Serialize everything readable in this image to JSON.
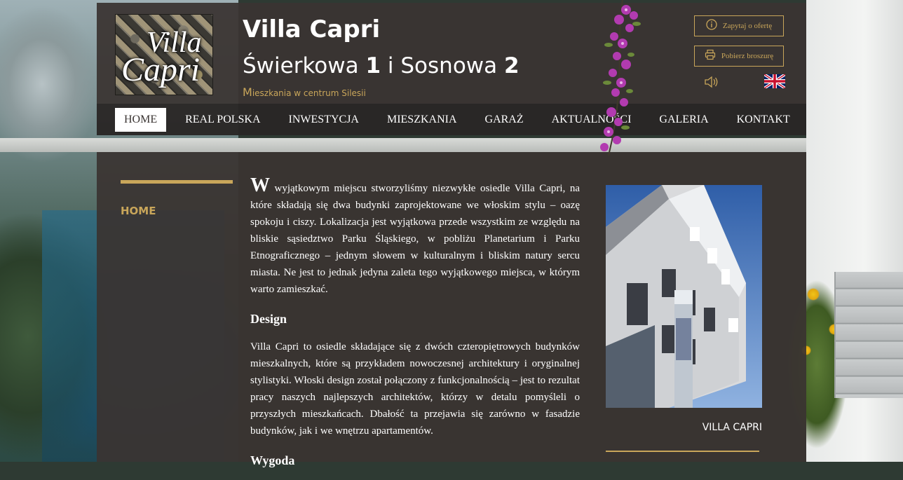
{
  "header": {
    "logo_line1": "Villa",
    "logo_line2": "Capri",
    "title": "Villa Capri",
    "subtitle": {
      "street1": "Świerkowa ",
      "num1": "1",
      "mid": " i Sosnowa ",
      "num2": "2"
    },
    "tagline_initial": "M",
    "tagline_rest": "ieszkania w centrum Silesii",
    "buttons": {
      "offer_label": "Zapytaj o ofertę",
      "brochure_label": "Pobierz broszurę"
    }
  },
  "nav": {
    "items": [
      {
        "label": "HOME"
      },
      {
        "label": "REAL POLSKA"
      },
      {
        "label": "INWESTYCJA"
      },
      {
        "label": "MIESZKANIA"
      },
      {
        "label": "GARAŻ"
      },
      {
        "label": "AKTUALNOŚCI"
      },
      {
        "label": "GALERIA"
      },
      {
        "label": "KONTAKT"
      }
    ]
  },
  "sidebar": {
    "link": "HOME"
  },
  "article": {
    "intro_cap": "W",
    "intro_rest": " wyjątkowym miejscu stworzyliśmy niezwykłe osiedle Villa Capri, na które składają się dwa budynki zaprojektowane we włoskim stylu – oazę spokoju i ciszy. Lokalizacja jest wyjątkowa przede wszystkim ze względu na bliskie sąsiedztwo Parku Śląskiego, w pobliżu Planetarium i Parku Etnograficznego – jednym słowem w kulturalnym i bliskim natury sercu miasta. Ne jest to jednak jedyna zaleta tego wyjątkowego miejsca, w którym warto zamieszkać.",
    "design_heading": "Design",
    "design_text": "Villa Capri to osiedle składające się z dwóch czteropiętrowych budynków mieszkalnych, które są przykładem nowoczesnej architektury i oryginalnej stylistyki. Włoski design został połączony z funkcjonalnością – jest to rezultat pracy naszych najlepszych architektów, którzy w detalu pomyśleli o przyszłych mieszkańcach. Dbałość ta przejawia się zarówno w fasadzie budynków, jak i we wnętrzu apartamentów.",
    "next_heading": "Wygoda"
  },
  "photo": {
    "caption": "VILLA CAPRI"
  },
  "colors": {
    "accent": "#c9a65a",
    "panel": "#3a3432"
  }
}
